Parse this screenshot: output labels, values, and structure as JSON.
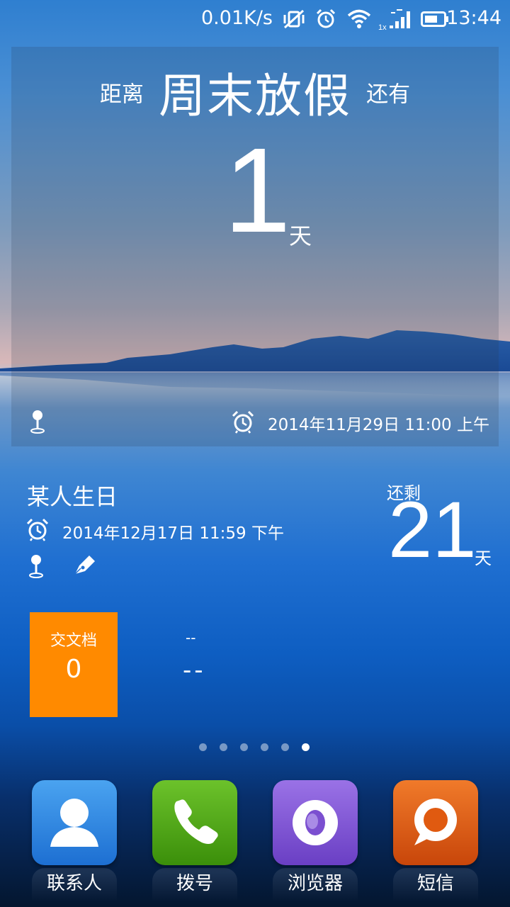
{
  "status_bar": {
    "speed": "0.01K/s",
    "time": "13:44",
    "network_label": "1x",
    "icons": [
      "vibrate-off-icon",
      "alarm-icon",
      "wifi-icon",
      "signal-icon",
      "battery-icon"
    ]
  },
  "countdown": {
    "prefix": "距离",
    "event": "周末放假",
    "suffix": "还有",
    "value": "1",
    "unit": "天",
    "datetime": "2014年11月29日 11:00 上午"
  },
  "birthday": {
    "title": "某人生日",
    "datetime": "2014年12月17日 11:59 下午",
    "remain_label": "还剩",
    "remain_value": "21",
    "remain_unit": "天"
  },
  "todo": {
    "label": "交文档",
    "count": "0",
    "placeholder_small": "--",
    "placeholder_big": "--",
    "color": "#ff8a00"
  },
  "page_indicator": {
    "count": 6,
    "active_index": 5
  },
  "dock": [
    {
      "label": "联系人",
      "icon": "contacts-icon",
      "color": "#2f86e0"
    },
    {
      "label": "拨号",
      "icon": "phone-icon",
      "color": "#4aa312"
    },
    {
      "label": "浏览器",
      "icon": "browser-icon",
      "color": "#7b4fd0"
    },
    {
      "label": "短信",
      "icon": "messages-icon",
      "color": "#e05a10"
    }
  ]
}
